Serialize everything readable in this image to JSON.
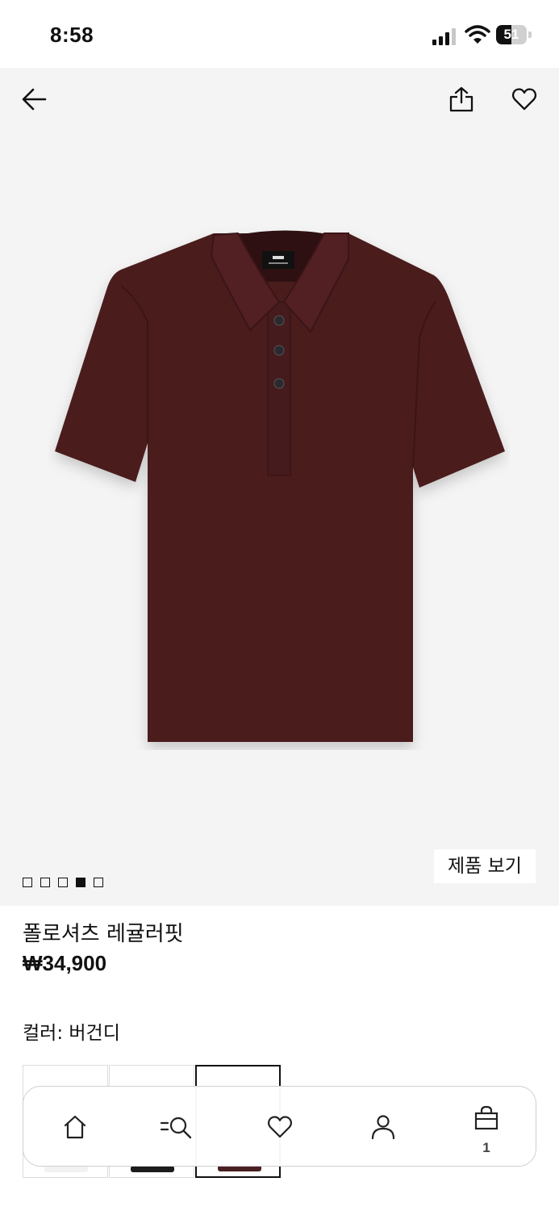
{
  "status": {
    "time": "8:58",
    "battery_level": "51",
    "battery_fraction": 0.51
  },
  "header": {
    "back_icon": "arrow-left-icon",
    "share_icon": "share-icon",
    "favorite_icon": "heart-icon"
  },
  "gallery": {
    "image_count": 5,
    "active_index": 3,
    "view_product_label": "제품 보기"
  },
  "product": {
    "name": "폴로셔츠 레귤러핏",
    "price": "₩34,900",
    "color_label": "컬러: 버건디"
  },
  "swatches": [
    {
      "color": "#f2f2f2",
      "selected": false
    },
    {
      "color": "#1c1c1c",
      "selected": false
    },
    {
      "color": "#4a1f22",
      "selected": true
    }
  ],
  "bottom_nav": {
    "items": [
      {
        "name": "home",
        "icon": "home-icon"
      },
      {
        "name": "search",
        "icon": "search-icon"
      },
      {
        "name": "favorites",
        "icon": "heart-icon"
      },
      {
        "name": "account",
        "icon": "user-icon"
      },
      {
        "name": "bag",
        "icon": "shopping-bag-icon"
      }
    ],
    "bag_count": "1"
  },
  "colors": {
    "accent": "#111111",
    "product_bg": "#f4f4f4",
    "shirt": "#4b1d1f"
  }
}
